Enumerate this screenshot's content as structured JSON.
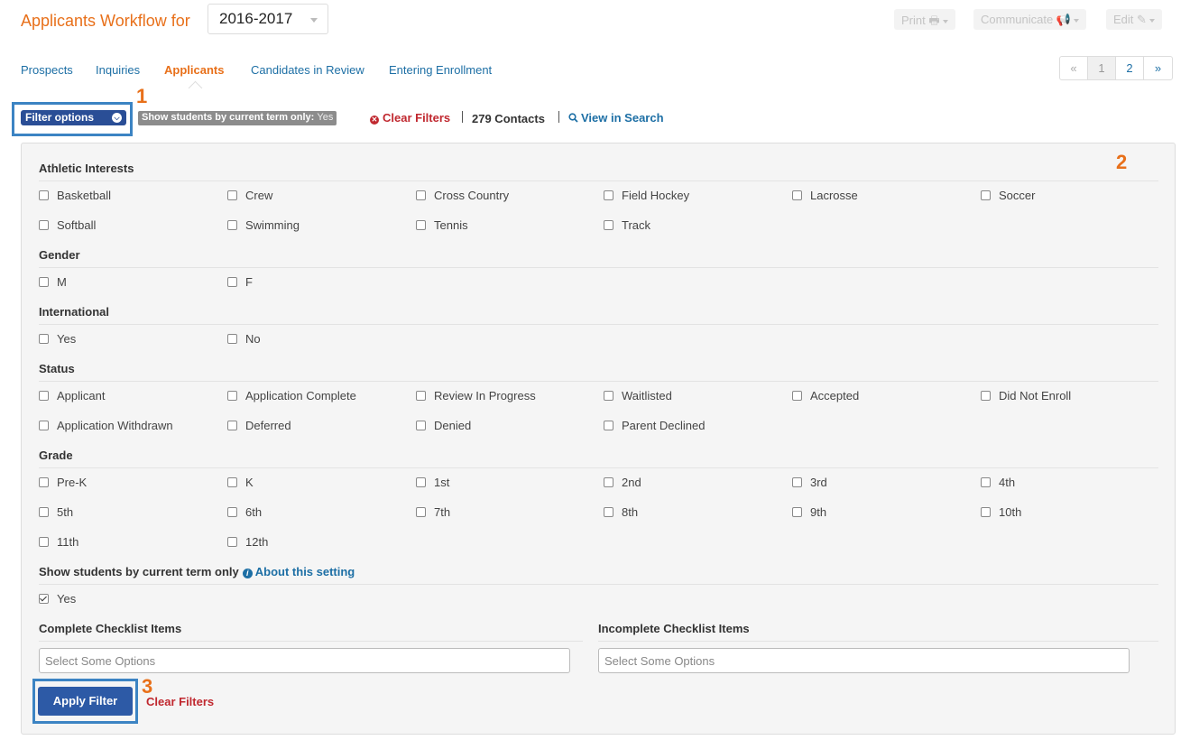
{
  "header": {
    "title": "Applicants Workflow for",
    "year": "2016-2017",
    "print_label": "Print 🖶",
    "communicate_label": "Communicate 📢",
    "edit_label": "Edit ✎"
  },
  "tabs": [
    {
      "label": "Prospects"
    },
    {
      "label": "Inquiries"
    },
    {
      "label": "Applicants",
      "active": true
    },
    {
      "label": "Candidates in Review"
    },
    {
      "label": "Entering Enrollment"
    }
  ],
  "pagination": {
    "prev": "«",
    "pages": [
      "1",
      "2"
    ],
    "next": "»",
    "current": "1"
  },
  "filter_bar": {
    "filter_options_label": "Filter options",
    "term_badge_label": "Show students by current term only:",
    "term_badge_value": "Yes",
    "clear_filters": "Clear Filters",
    "contacts": "279 Contacts",
    "view_in_search": "View in Search"
  },
  "callout_numbers": {
    "one": "1",
    "two": "2",
    "three": "3"
  },
  "filters": {
    "athletic": {
      "title": "Athletic Interests",
      "options": [
        "Basketball",
        "Crew",
        "Cross Country",
        "Field Hockey",
        "Lacrosse",
        "Soccer",
        "Softball",
        "Swimming",
        "Tennis",
        "Track"
      ]
    },
    "gender": {
      "title": "Gender",
      "options": [
        "M",
        "F"
      ]
    },
    "international": {
      "title": "International",
      "options": [
        "Yes",
        "No"
      ]
    },
    "status": {
      "title": "Status",
      "options": [
        "Applicant",
        "Application Complete",
        "Review In Progress",
        "Waitlisted",
        "Accepted",
        "Did Not Enroll",
        "Application Withdrawn",
        "Deferred",
        "Denied",
        "Parent Declined"
      ]
    },
    "grade": {
      "title": "Grade",
      "options": [
        "Pre-K",
        "K",
        "1st",
        "2nd",
        "3rd",
        "4th",
        "5th",
        "6th",
        "7th",
        "8th",
        "9th",
        "10th",
        "11th",
        "12th"
      ]
    },
    "current_term": {
      "title": "Show students by current term only",
      "about_link": "About this setting",
      "option": "Yes",
      "checked": true
    },
    "complete_checklist": {
      "title": "Complete Checklist Items",
      "placeholder": "Select Some Options"
    },
    "incomplete_checklist": {
      "title": "Incomplete Checklist Items",
      "placeholder": "Select Some Options"
    }
  },
  "actions": {
    "apply_filter": "Apply Filter",
    "clear_filters": "Clear Filters"
  },
  "colors": {
    "accent_orange": "#e8701a",
    "link_blue": "#1d6fa5",
    "primary_button": "#2d5aa6",
    "danger_red": "#c0282f",
    "callout_border": "#3c84c3"
  }
}
